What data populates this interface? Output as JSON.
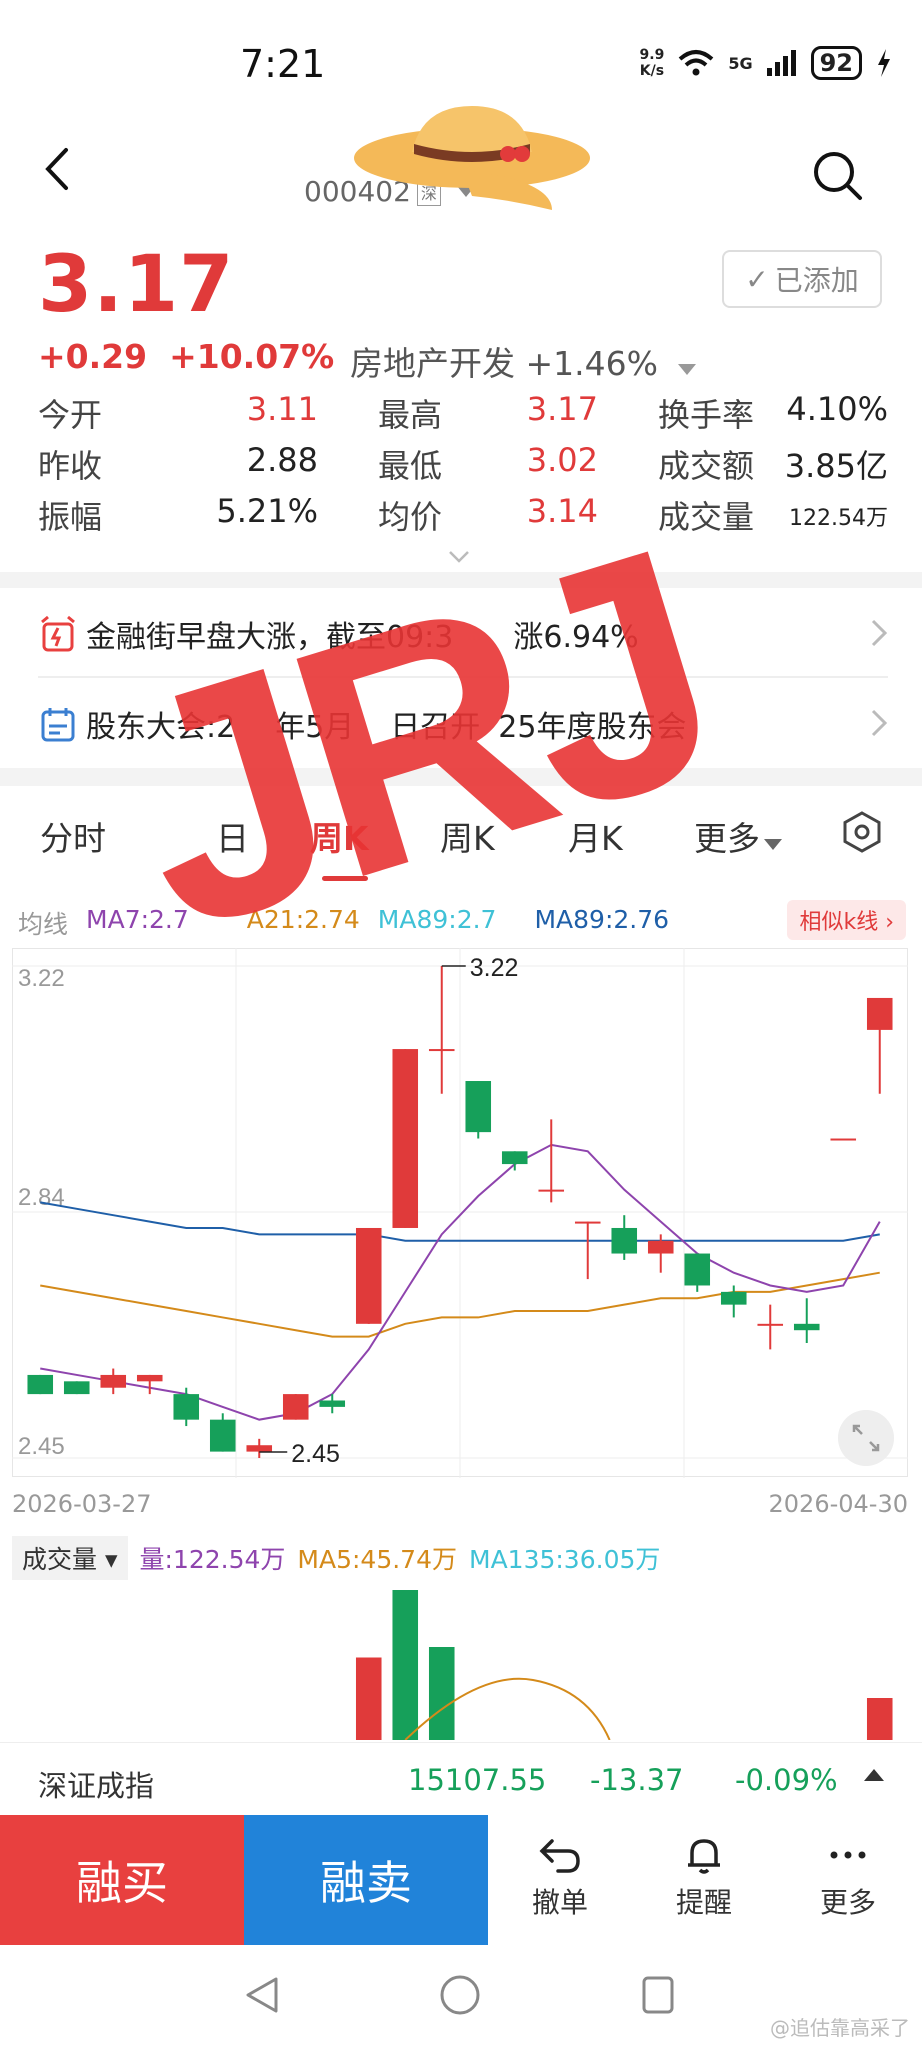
{
  "status_bar": {
    "time": "7:21",
    "speed": "9.9",
    "speed_unit": "K/s",
    "network": "5G",
    "battery": "92"
  },
  "header": {
    "code": "000402",
    "market_tag": "深"
  },
  "quote": {
    "price": "3.17",
    "change": "+0.29",
    "change_pct": "+10.07%",
    "sector": "房地产开发",
    "sector_change": "+1.46%",
    "watch_label": "已添加",
    "fields": [
      {
        "label": "今开",
        "value": "3.11"
      },
      {
        "label": "最高",
        "value": "3.17"
      },
      {
        "label": "换手率",
        "value": "4.10%"
      },
      {
        "label": "昨收",
        "value": "2.88"
      },
      {
        "label": "最低",
        "value": "3.02"
      },
      {
        "label": "成交额",
        "value": "3.85亿"
      },
      {
        "label": "振幅",
        "value": "5.21%"
      },
      {
        "label": "均价",
        "value": "3.14"
      },
      {
        "label": "成交量",
        "value": "122.54万"
      }
    ]
  },
  "news": [
    {
      "text": "金融街早盘大涨，截至09:3",
      "tail": "涨6.94%"
    },
    {
      "text": "股东大会:2",
      "mid": "年5月",
      "mid2": "日召开",
      "tail": "25年度股东会"
    }
  ],
  "tabs": [
    "分时",
    "日",
    "周K",
    "周K",
    "月K",
    "更多"
  ],
  "ma": {
    "label": "均线",
    "ma7": "MA7:2.7",
    "ma21": "A21:2.74",
    "ma89a": "MA89:2.7",
    "ma89b": "MA89:2.76",
    "similar_label": "相似k线"
  },
  "colors": {
    "up": "#e03a3a",
    "down": "#16a05a",
    "ma7": "#8e44ad",
    "ma21": "#d48a1a",
    "ma89a": "#3fc1d6",
    "ma89b": "#1f5fa8"
  },
  "chart_data": {
    "type": "candlestick",
    "y_ticks": [
      "3.22",
      "2.84",
      "2.45"
    ],
    "ylim": [
      2.45,
      3.22
    ],
    "max_label": "3.22",
    "min_label": "2.45",
    "start_date": "2026-03-27",
    "end_date": "2026-04-30",
    "candles": [
      {
        "o": 2.58,
        "c": 2.55,
        "h": 2.58,
        "l": 2.55
      },
      {
        "o": 2.57,
        "c": 2.55,
        "h": 2.57,
        "l": 2.55
      },
      {
        "o": 2.56,
        "c": 2.58,
        "h": 2.59,
        "l": 2.55
      },
      {
        "o": 2.57,
        "c": 2.58,
        "h": 2.58,
        "l": 2.55
      },
      {
        "o": 2.55,
        "c": 2.51,
        "h": 2.56,
        "l": 2.5
      },
      {
        "o": 2.51,
        "c": 2.46,
        "h": 2.52,
        "l": 2.46
      },
      {
        "o": 2.46,
        "c": 2.47,
        "h": 2.48,
        "l": 2.45
      },
      {
        "o": 2.51,
        "c": 2.55,
        "h": 2.55,
        "l": 2.51
      },
      {
        "o": 2.54,
        "c": 2.53,
        "h": 2.55,
        "l": 2.52
      },
      {
        "o": 2.66,
        "c": 2.81,
        "h": 2.81,
        "l": 2.66
      },
      {
        "o": 2.81,
        "c": 3.09,
        "h": 3.09,
        "l": 2.81
      },
      {
        "o": 3.09,
        "c": 3.09,
        "h": 3.22,
        "l": 3.02
      },
      {
        "o": 3.04,
        "c": 2.96,
        "h": 3.04,
        "l": 2.95
      },
      {
        "o": 2.93,
        "c": 2.91,
        "h": 2.93,
        "l": 2.9
      },
      {
        "o": 2.87,
        "c": 2.87,
        "h": 2.98,
        "l": 2.85
      },
      {
        "o": 2.82,
        "c": 2.82,
        "h": 2.82,
        "l": 2.73
      },
      {
        "o": 2.81,
        "c": 2.77,
        "h": 2.83,
        "l": 2.76
      },
      {
        "o": 2.77,
        "c": 2.79,
        "h": 2.8,
        "l": 2.74
      },
      {
        "o": 2.77,
        "c": 2.72,
        "h": 2.77,
        "l": 2.71
      },
      {
        "o": 2.71,
        "c": 2.69,
        "h": 2.72,
        "l": 2.67
      },
      {
        "o": 2.66,
        "c": 2.66,
        "h": 2.69,
        "l": 2.62
      },
      {
        "o": 2.66,
        "c": 2.65,
        "h": 2.7,
        "l": 2.63
      },
      {
        "o": 2.95,
        "c": 2.95,
        "h": 2.95,
        "l": 2.95
      },
      {
        "o": 3.12,
        "c": 3.17,
        "h": 3.17,
        "l": 3.02
      }
    ],
    "ma7": [
      2.59,
      2.58,
      2.57,
      2.56,
      2.55,
      2.53,
      2.51,
      2.52,
      2.55,
      2.62,
      2.71,
      2.8,
      2.86,
      2.91,
      2.94,
      2.93,
      2.87,
      2.82,
      2.77,
      2.74,
      2.72,
      2.71,
      2.72,
      2.82
    ],
    "ma21": [
      2.72,
      2.71,
      2.7,
      2.69,
      2.68,
      2.67,
      2.66,
      2.65,
      2.64,
      2.64,
      2.66,
      2.67,
      2.67,
      2.68,
      2.68,
      2.68,
      2.69,
      2.7,
      2.7,
      2.71,
      2.71,
      2.72,
      2.73,
      2.74
    ],
    "ma89": [
      2.85,
      2.84,
      2.83,
      2.82,
      2.81,
      2.81,
      2.8,
      2.8,
      2.8,
      2.8,
      2.79,
      2.79,
      2.79,
      2.79,
      2.79,
      2.79,
      2.79,
      2.79,
      2.79,
      2.79,
      2.79,
      2.79,
      2.79,
      2.8
    ]
  },
  "volume": {
    "selector": "成交量",
    "vol": "量:122.54万",
    "ma5": "MA5:45.74万",
    "ma135": "MA135:36.05万"
  },
  "volume_data": {
    "bars": [
      0,
      0,
      0,
      0,
      0,
      0,
      0,
      0,
      0,
      0.55,
      1.0,
      0.62,
      0,
      0,
      0,
      0,
      0,
      0,
      0,
      0,
      0,
      0,
      0,
      0.28
    ],
    "colors": [
      "",
      "",
      "",
      "",
      "",
      "",
      "",
      "",
      "",
      "up",
      "down",
      "down",
      "",
      "",
      "",
      "",
      "",
      "",
      "",
      "",
      "",
      "",
      "",
      "up"
    ]
  },
  "index": {
    "name": "深证成指",
    "value": "15107.55",
    "change": "-13.37",
    "pct": "-0.09%"
  },
  "bottom_bar": {
    "buy": "融买",
    "sell": "融卖",
    "cancel": "撤单",
    "alert": "提醒",
    "more": "更多"
  },
  "watermark": {
    "big": "JRJ",
    "corner": "@追估靠高采了"
  }
}
